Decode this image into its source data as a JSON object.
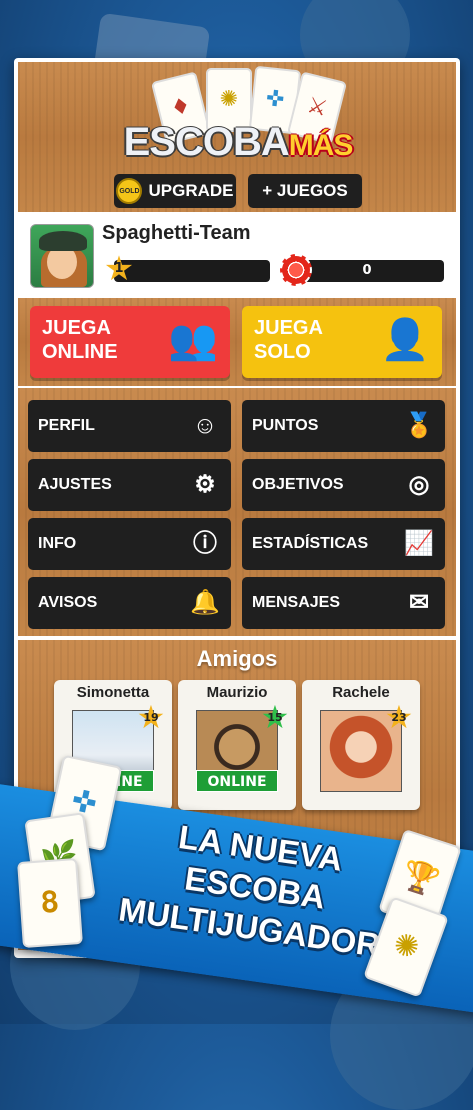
{
  "header": {
    "logo_main": "ESCOBA",
    "logo_sub": "MÁS",
    "gold_badge": "GOLD",
    "upgrade_label": "UPGRADE",
    "games_label": "+ JUEGOS"
  },
  "profile": {
    "name": "Spaghetti-Team",
    "level": "1",
    "chips": "0"
  },
  "play": {
    "online_line1": "JUEGA",
    "online_line2": "ONLINE",
    "solo_line1": "JUEGA",
    "solo_line2": "SOLO",
    "online_color": "#ef3b3b",
    "solo_color": "#f5c20f"
  },
  "menu": {
    "items": [
      {
        "label": "PERFIL",
        "icon": "user-icon"
      },
      {
        "label": "PUNTOS",
        "icon": "ribbon-award-icon"
      },
      {
        "label": "AJUSTES",
        "icon": "gear-icon"
      },
      {
        "label": "OBJETIVOS",
        "icon": "target-icon"
      },
      {
        "label": "INFO",
        "icon": "info-icon"
      },
      {
        "label": "ESTADÍSTICAS",
        "icon": "chart-icon"
      },
      {
        "label": "AVISOS",
        "icon": "bell-icon"
      },
      {
        "label": "MENSAJES",
        "icon": "mail-icon"
      }
    ]
  },
  "friends": {
    "title": "Amigos",
    "list": [
      {
        "name": "Simonetta",
        "level": "19",
        "online": true,
        "online_label": "ONLINE"
      },
      {
        "name": "Maurizio",
        "level": "15",
        "online": true,
        "online_label": "ONLINE"
      },
      {
        "name": "Rachele",
        "level": "23",
        "online": false,
        "online_label": ""
      }
    ]
  },
  "promo": {
    "line1": "LA NUEVA ESCOBA",
    "line2": "MULTIJUGADOR"
  }
}
